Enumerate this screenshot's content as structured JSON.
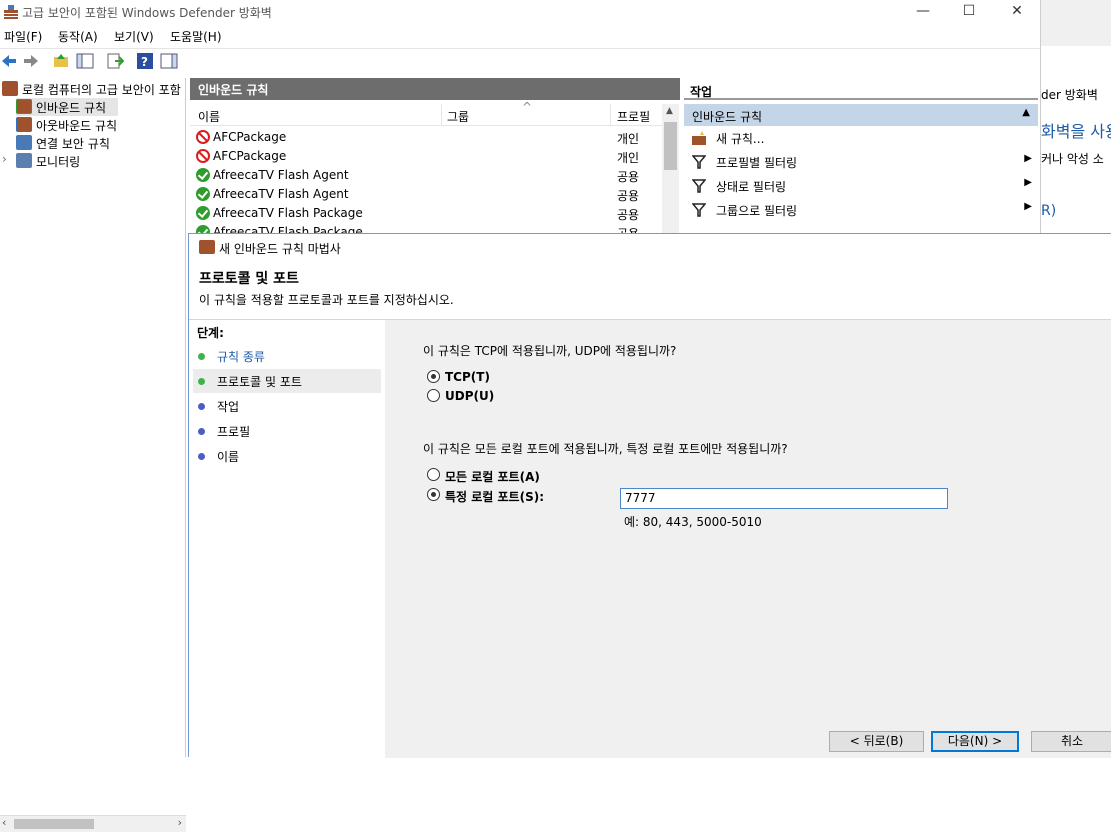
{
  "main_window": {
    "title": "고급 보안이 포함된 Windows Defender 방화벽",
    "minimize": "—",
    "maximize": "☐",
    "close": "✕"
  },
  "menu": [
    "파일(F)",
    "동작(A)",
    "보기(V)",
    "도움말(H)"
  ],
  "tree": {
    "root": "로컬 컴퓨터의 고급 보안이 포함",
    "items": [
      "인바운드 규칙",
      "아웃바운드 규칙",
      "연결 보안 규칙",
      "모니터링"
    ]
  },
  "list": {
    "header": "인바운드 규칙",
    "columns": [
      "이름",
      "그룹",
      "프로필"
    ],
    "rows": [
      {
        "name": "AFCPackage",
        "profile": "개인",
        "status": "block"
      },
      {
        "name": "AFCPackage",
        "profile": "개인",
        "status": "block"
      },
      {
        "name": "AfreecaTV Flash Agent",
        "profile": "공용",
        "status": "allow"
      },
      {
        "name": "AfreecaTV Flash Agent",
        "profile": "공용",
        "status": "allow"
      },
      {
        "name": "AfreecaTV Flash Package",
        "profile": "공용",
        "status": "allow"
      },
      {
        "name": "AfreecaTV Flash Package",
        "profile": "공용",
        "status": "allow"
      }
    ]
  },
  "actions": {
    "header": "작업",
    "section": "인바운드 규칙",
    "items": [
      "새 규칙...",
      "프로필별 필터링",
      "상태로 필터링",
      "그룹으로 필터링"
    ]
  },
  "background_window": {
    "line1": "der 방화벽",
    "line2": "화벽을 사용",
    "line3": "커나 악성 소",
    "line4": "R)"
  },
  "wizard": {
    "title": "새 인바운드 규칙 마법사",
    "heading": "프로토콜 및 포트",
    "description": "이 규칙을 적용할 프로토콜과 포트를 지정하십시오.",
    "steps_header": "단계:",
    "steps": [
      {
        "label": "규칙 종류",
        "color": "#3cb44b"
      },
      {
        "label": "프로토콜 및 포트",
        "color": "#3cb44b"
      },
      {
        "label": "작업",
        "color": "#4b5cc4"
      },
      {
        "label": "프로필",
        "color": "#4b5cc4"
      },
      {
        "label": "이름",
        "color": "#4b5cc4"
      }
    ],
    "question1": "이 규칙은 TCP에 적용됩니까, UDP에 적용됩니까?",
    "tcp_label": "TCP(T)",
    "udp_label": "UDP(U)",
    "question2": "이 규칙은 모든 로컬 포트에 적용됩니까, 특정 로컬 포트에만 적용됩니까?",
    "all_ports_label": "모든 로컬 포트(A)",
    "specific_ports_label": "특정 로컬 포트(S):",
    "port_value": "7777",
    "port_hint": "예: 80, 443, 5000-5010",
    "back_button": "< 뒤로(B)",
    "next_button": "다음(N) >",
    "cancel_button": "취소"
  }
}
